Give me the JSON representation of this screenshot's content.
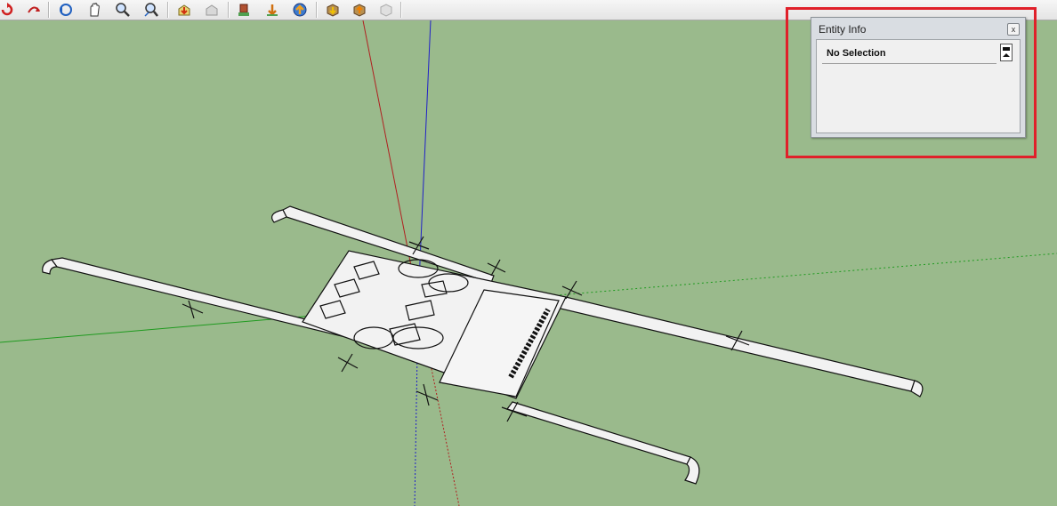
{
  "toolbar": {
    "buttons": [
      {
        "name": "orbit-icon"
      },
      {
        "name": "pan-icon"
      },
      {
        "name": "zoom-icon"
      },
      {
        "name": "zoom-extents-icon"
      },
      {
        "name": "get-models-icon"
      },
      {
        "name": "share-model-icon"
      },
      {
        "name": "place-model-icon"
      },
      {
        "name": "add-location-icon"
      },
      {
        "name": "toggle-terrain-icon"
      },
      {
        "name": "get-component-icon"
      },
      {
        "name": "share-component-icon"
      },
      {
        "name": "warehouse-icon"
      }
    ]
  },
  "entity_info": {
    "title": "Entity Info",
    "close_glyph": "x",
    "selection_text": "No Selection"
  },
  "colors": {
    "viewport_bg": "#9aba8c",
    "highlight": "#e0202a",
    "red_axis": "#b02020",
    "green_axis": "#1f9a1f",
    "blue_axis": "#2020c8"
  }
}
